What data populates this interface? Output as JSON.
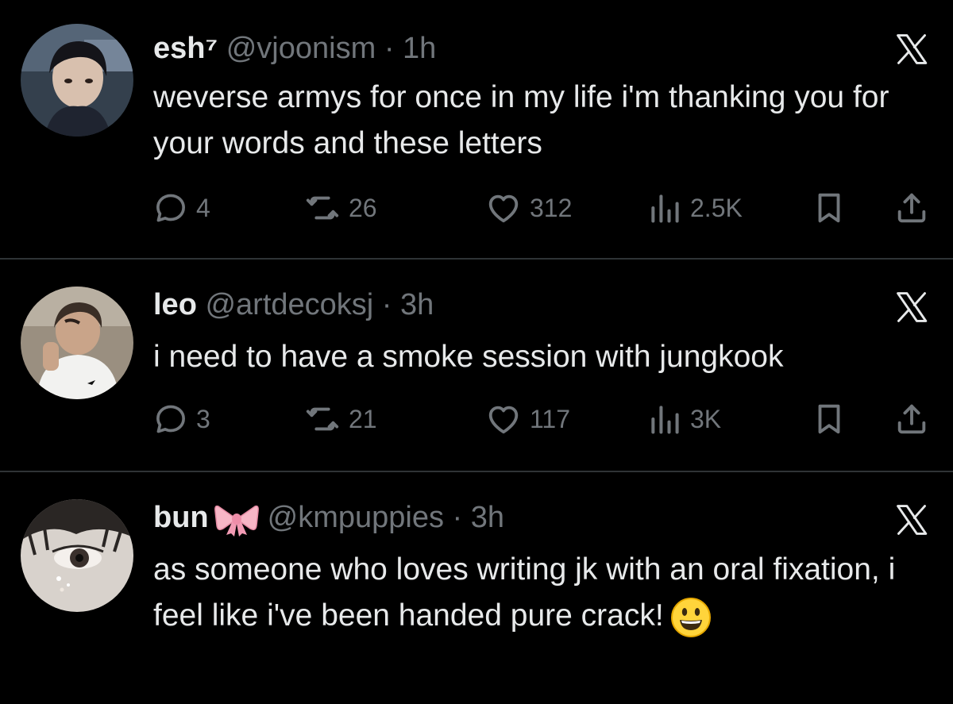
{
  "colors": {
    "background": "#000000",
    "text_primary": "#e7e9ea",
    "text_secondary": "#71767b",
    "divider": "#2f3336"
  },
  "tweets": [
    {
      "name": "esh⁷",
      "handle": "@vjoonism",
      "separator": "·",
      "time": "1h",
      "text": "weverse armys for once in my life i'm thanking you for your words and these letters",
      "replies": "4",
      "reposts": "26",
      "likes": "312",
      "views": "2.5K",
      "avatar_icon": "avatar-photo"
    },
    {
      "name": "leo",
      "handle": "@artdecoksj",
      "separator": "·",
      "time": "3h",
      "text": "i need to have a smoke session with jungkook",
      "replies": "3",
      "reposts": "21",
      "likes": "117",
      "views": "3K",
      "avatar_icon": "avatar-photo"
    },
    {
      "name": "bun",
      "name_emoji": "ribbon-bow-emoji",
      "handle": "@kmpuppies",
      "separator": "·",
      "time": "3h",
      "text": "as someone who loves writing jk with an oral fixation, i feel like i've been handed pure crack!",
      "text_emoji": "smiley-face-emoji",
      "avatar_icon": "avatar-photo"
    }
  ]
}
